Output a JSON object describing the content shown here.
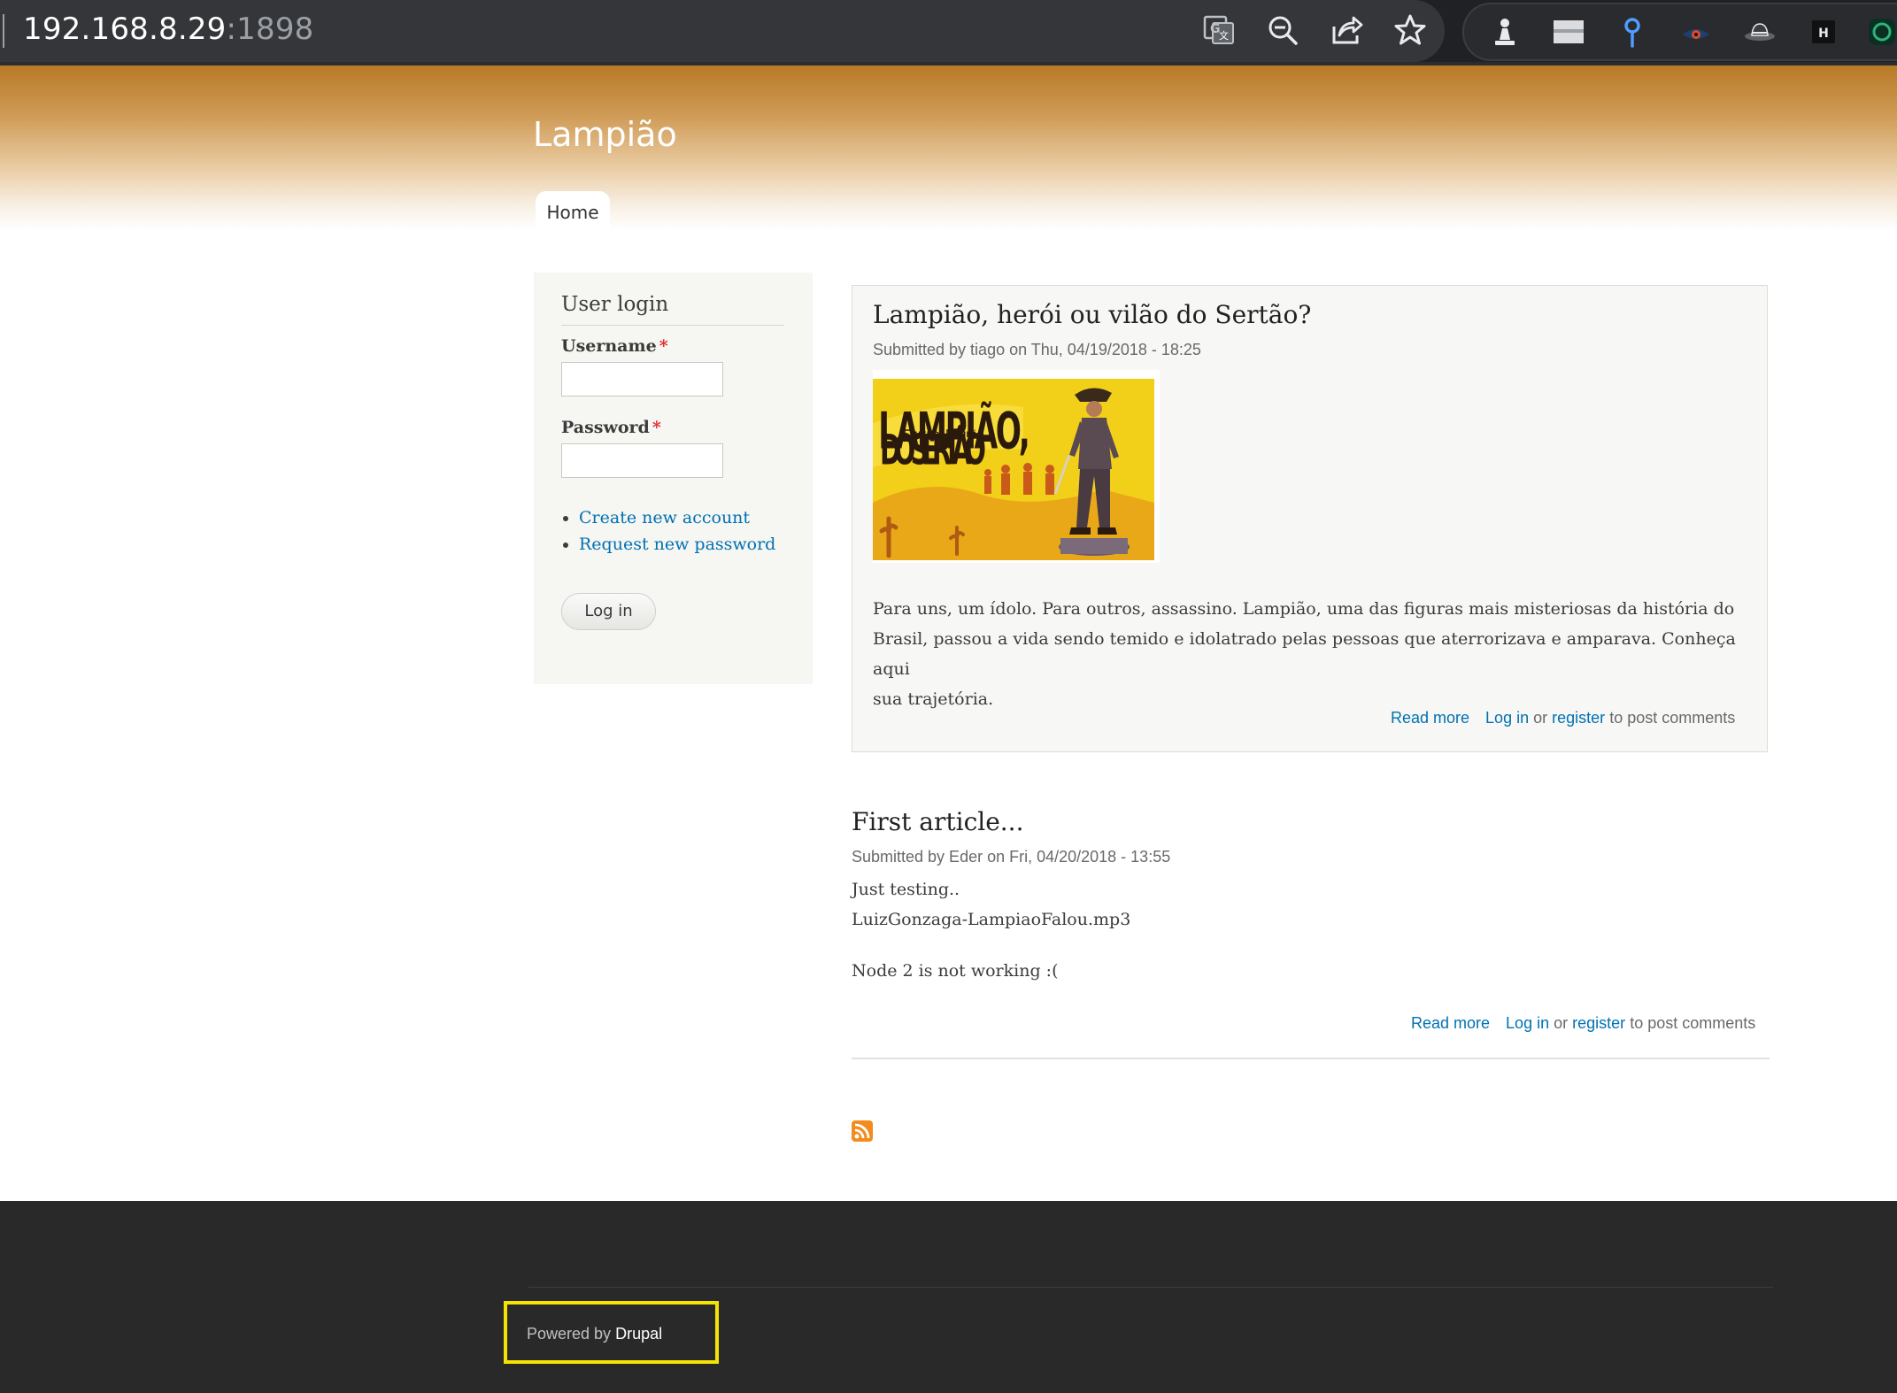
{
  "browser": {
    "url_host": "192.168.8.29",
    "url_port": ":1898",
    "toolbar_icons": [
      "google-translate-icon",
      "zoom-out-icon",
      "share-icon",
      "bookmark-star-icon"
    ],
    "extension_icons": [
      "chess-pawn-icon",
      "window-icon",
      "location-pin-icon",
      "eye-extension-icon",
      "hat-icon",
      "h-extension-icon",
      "circle-extension-icon"
    ]
  },
  "site": {
    "name": "Lampião",
    "nav": {
      "home": "Home"
    },
    "colors": {
      "header_top": "#b87a26",
      "link": "#0071b3",
      "footer_bg": "#292929",
      "highlight": "#f4e404"
    }
  },
  "login": {
    "title": "User login",
    "username_label": "Username",
    "password_label": "Password",
    "required_mark": "*",
    "username_value": "",
    "password_value": "",
    "links": [
      "Create new account",
      "Request new password"
    ],
    "button": "Log in"
  },
  "nodes": [
    {
      "title": "Lampião, herói ou vilão do Sertão?",
      "submitted": "Submitted by tiago on Thu, 04/19/2018 - 18:25",
      "image": {
        "line1": "LAMPIÃO,",
        "opt1": "HERÓI",
        "opt2": "VILÃO",
        "line2": "DO SERTÃO"
      },
      "body": [
        "Para uns, um ídolo. Para outros, assassino. Lampião, uma das figuras mais misteriosas da história do",
        "Brasil, passou a vida sendo temido e idolatrado pelas pessoas que aterrorizava e amparava. Conheça aqui",
        "sua trajetória."
      ],
      "read_more": "Read more",
      "log_in": "Log in",
      "or": "or",
      "register": "register",
      "to_post": "to post comments"
    },
    {
      "title": "First article...",
      "submitted": "Submitted by Eder on Fri, 04/20/2018 - 13:55",
      "body": [
        "Just testing..",
        "LuizGonzaga-LampiaoFalou.mp3",
        "Node 2 is not working :("
      ],
      "read_more": "Read more",
      "log_in": "Log in",
      "or": "or",
      "register": "register",
      "to_post": "to post comments"
    }
  ],
  "footer": {
    "powered_by": "Powered by",
    "drupal": "Drupal"
  }
}
